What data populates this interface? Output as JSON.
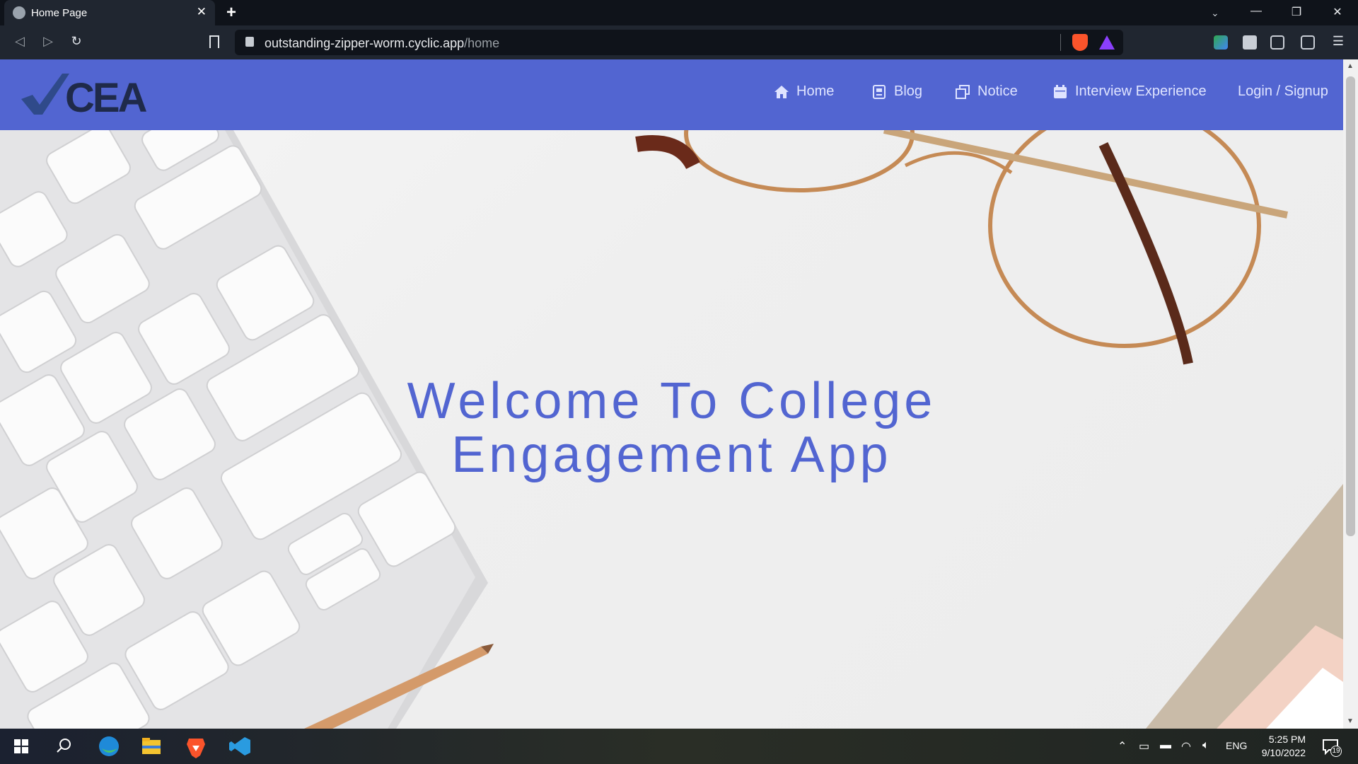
{
  "browser": {
    "tab_title": "Home Page",
    "url_host": "outstanding-zipper-worm.cyclic.app",
    "url_path": "/home"
  },
  "site": {
    "logo_text": "CEA",
    "nav": {
      "home": "Home",
      "blog": "Blog",
      "notice": "Notice",
      "interview": "Interview Experience",
      "login": "Login / Signup"
    },
    "hero": {
      "title_line1": "Welcome To College",
      "title_line2": "Engagement App"
    }
  },
  "taskbar": {
    "language": "ENG",
    "time": "5:25 PM",
    "date": "9/10/2022",
    "notification_count": "19"
  },
  "colors": {
    "accent": "#5265d1",
    "logo_check": "#2f4a8a",
    "logo_text": "#1f2a4a"
  }
}
